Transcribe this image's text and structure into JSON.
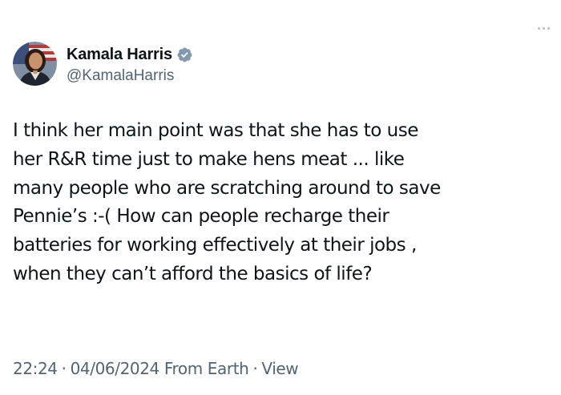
{
  "tweet": {
    "author": {
      "display_name": "Kamala Harris",
      "handle": "@KamalaHarris",
      "verified": true,
      "avatar_icon": "profile-photo",
      "verified_badge_color": "#829aab"
    },
    "text": "I think her main point was that she has to use\nher R&R time just to make hens meat ... like\nmany people who are scratching around to save\nPennie’s :-(  How can people recharge their\nbatteries for working effectively at their jobs ,\nwhen they can’t afford the basics of life?",
    "time": "22:24",
    "date": "04/06/2024",
    "source": "From Earth",
    "view_label": "View",
    "separator": "·"
  },
  "colors": {
    "text_primary": "#0f1419",
    "text_secondary": "#536471",
    "background": "#ffffff"
  }
}
